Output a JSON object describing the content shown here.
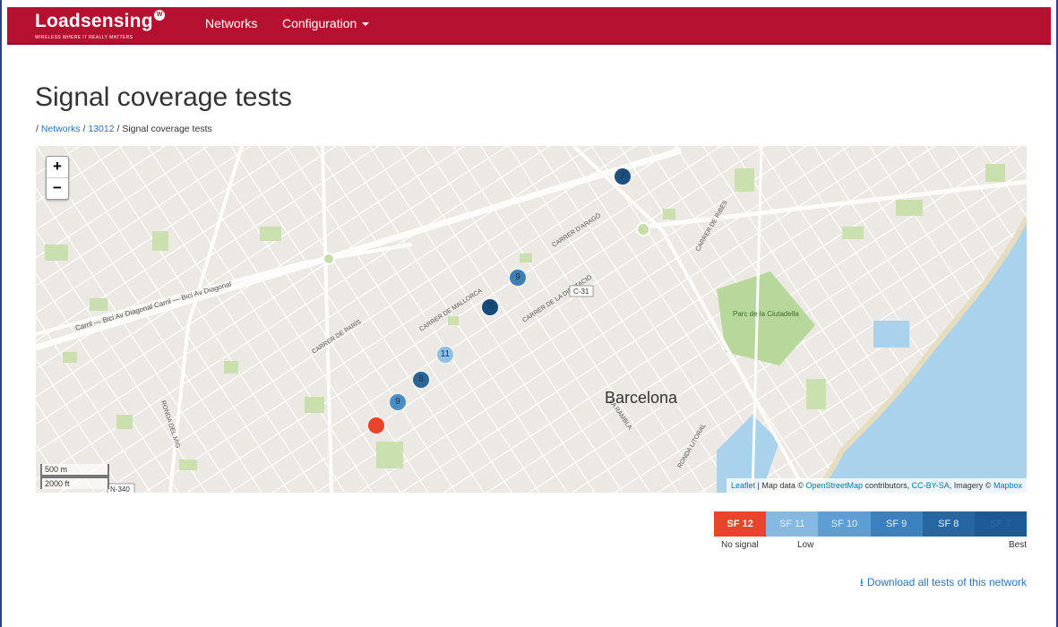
{
  "navbar": {
    "brand_name_bold": "Loadsensing",
    "brand_tagline": "WIRELESS WHERE IT REALLY MATTERS",
    "brand_badge": "W",
    "items": [
      {
        "label": "Networks"
      },
      {
        "label": "Configuration"
      }
    ]
  },
  "page": {
    "title": "Signal coverage tests",
    "breadcrumb": {
      "sep": "/",
      "items": [
        {
          "label": "Networks",
          "link": true
        },
        {
          "label": "13012",
          "link": true
        },
        {
          "label": "Signal coverage tests",
          "link": false
        }
      ]
    }
  },
  "map": {
    "zoom_in": "+",
    "zoom_out": "−",
    "scale_metric": "500 m",
    "scale_imperial": "2000 ft",
    "labels": {
      "city": "Barcelona",
      "park": "Parc de la Ciutadella",
      "road_c31": "C-31",
      "road_n340": "N-340",
      "streets": [
        "CARRER D'ARAGÓ",
        "CARRER DE MALLORCA",
        "CARRER DE LA DIPUTACIÓ",
        "CARRER DE PARÍS",
        "RONDA DEL MIG",
        "LA RAMBLA",
        "RONDA LITORAL",
        "CARRER DE RIBES",
        "Carril — Bici Av Diagonal Carril — Bici Av Diagonal"
      ]
    },
    "attribution": {
      "leaflet": "Leaflet",
      "text1": "| Map data ©",
      "osm": "OpenStreetMap",
      "text2": "contributors,",
      "license": "CC-BY-SA",
      "text3": ", Imagery ©",
      "mapbox": "Mapbox"
    },
    "markers": [
      {
        "label": "7",
        "color": "#1f4f7c"
      },
      {
        "label": "9",
        "color": "#3d7fb3"
      },
      {
        "label": "7",
        "color": "#164a7a"
      },
      {
        "label": "11",
        "color": "#8dc0e6"
      },
      {
        "label": "8",
        "color": "#2a6598"
      },
      {
        "label": "9",
        "color": "#4b8ec2"
      },
      {
        "label": "",
        "color": "#e8432b"
      }
    ]
  },
  "legend": {
    "items": [
      {
        "label": "SF 12",
        "color": "#e8452a"
      },
      {
        "label": "SF 11",
        "color": "#85b9e3"
      },
      {
        "label": "SF 10",
        "color": "#5d9ed4"
      },
      {
        "label": "SF 9",
        "color": "#3c81bf"
      },
      {
        "label": "SF 8",
        "color": "#2667a3"
      },
      {
        "label": "SF 7",
        "color": "#1b5a96"
      }
    ],
    "captions": {
      "left": "No signal",
      "mid": "Low",
      "right": "Best"
    }
  },
  "download_link": "Download all tests of this network"
}
